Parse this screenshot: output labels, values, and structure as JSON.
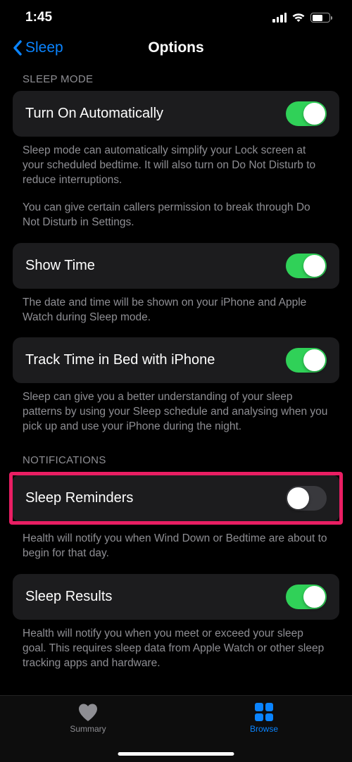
{
  "status": {
    "time": "1:45"
  },
  "nav": {
    "back_label": "Sleep",
    "title": "Options"
  },
  "sections": {
    "sleep_mode": {
      "header": "SLEEP MODE",
      "auto": {
        "label": "Turn On Automatically",
        "on": true,
        "desc1": "Sleep mode can automatically simplify your Lock screen at your scheduled bedtime. It will also turn on Do Not Disturb to reduce interruptions.",
        "desc2": "You can give certain callers permission to break through Do Not Disturb in Settings."
      },
      "show_time": {
        "label": "Show Time",
        "on": true,
        "desc": "The date and time will be shown on your iPhone and Apple Watch during Sleep mode."
      },
      "track": {
        "label": "Track Time in Bed with iPhone",
        "on": true,
        "desc": "Sleep can give you a better understanding of your sleep patterns by using your Sleep schedule and analysing when you pick up and use your iPhone during the night."
      }
    },
    "notifications": {
      "header": "NOTIFICATIONS",
      "reminders": {
        "label": "Sleep Reminders",
        "on": false,
        "desc": "Health will notify you when Wind Down or Bedtime are about to begin for that day."
      },
      "results": {
        "label": "Sleep Results",
        "on": true,
        "desc": "Health will notify you when you meet or exceed your sleep goal. This requires sleep data from Apple Watch or other sleep tracking apps and hardware."
      }
    }
  },
  "tabs": {
    "summary": "Summary",
    "browse": "Browse"
  }
}
